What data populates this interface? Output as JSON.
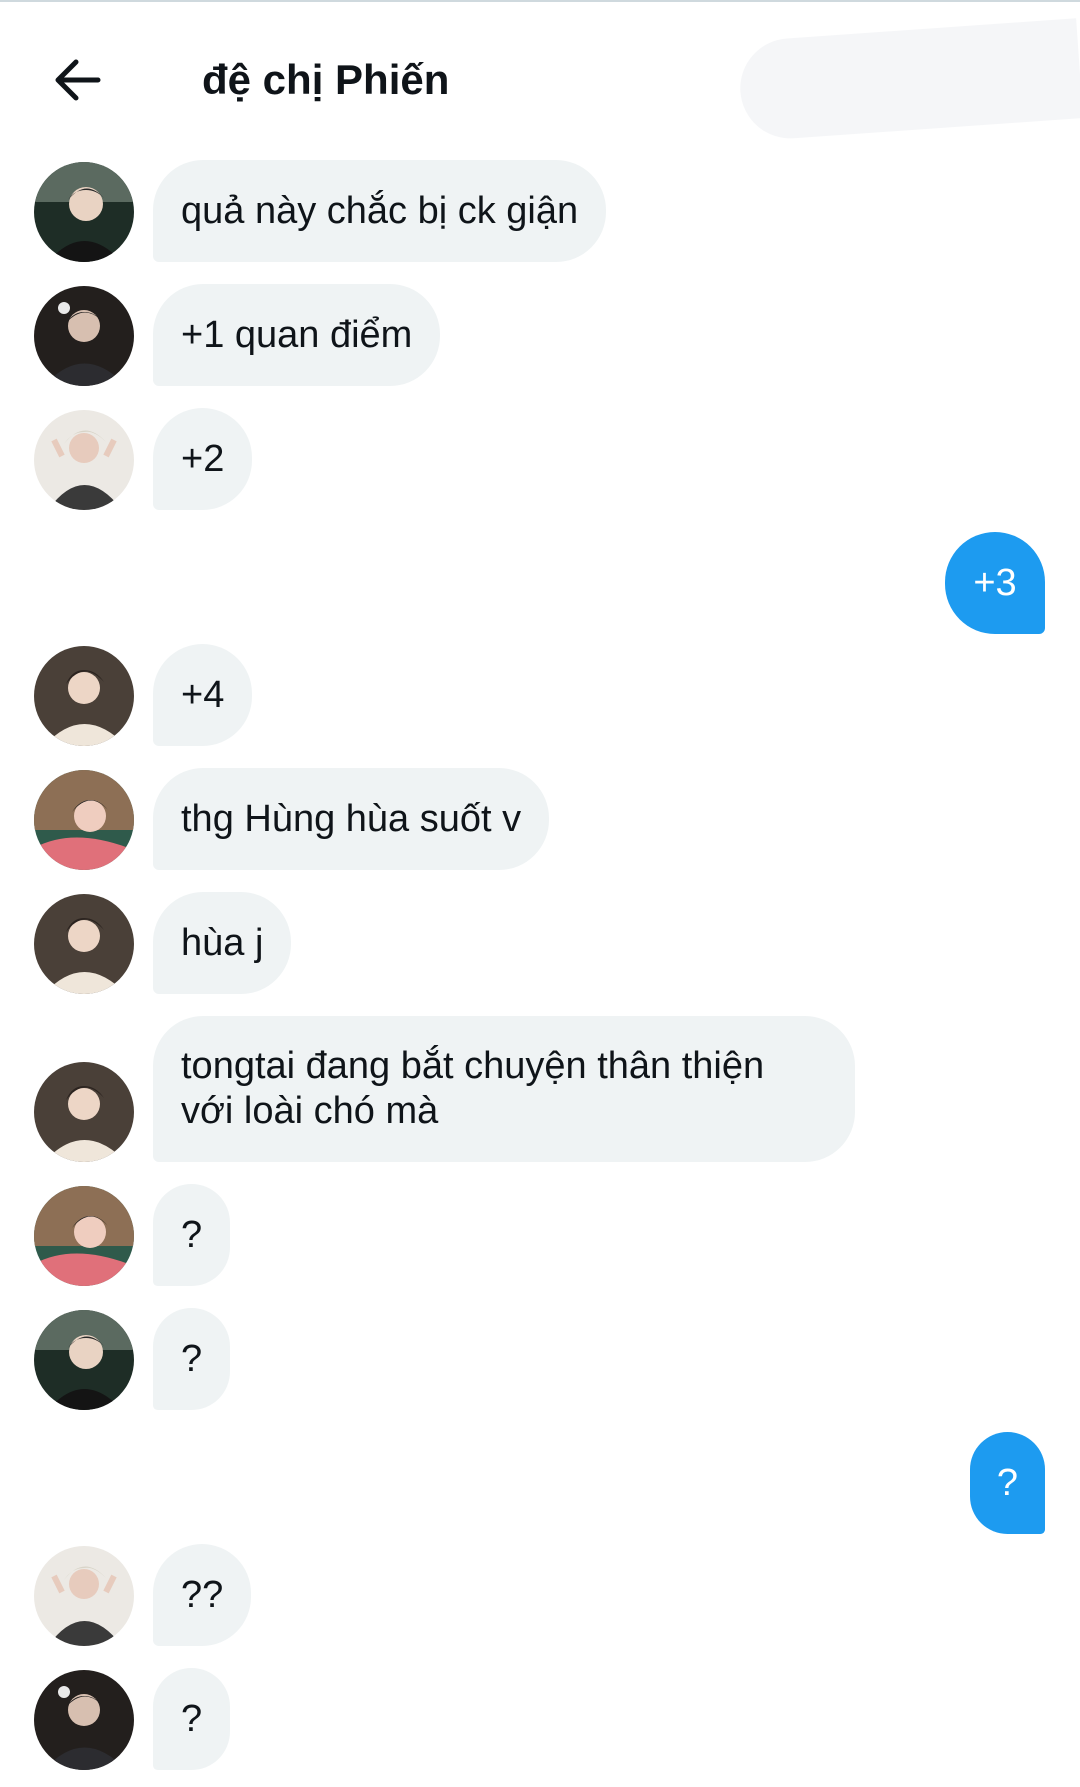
{
  "header": {
    "title": "đệ chị Phiến",
    "back_icon": "arrow-left-icon"
  },
  "colors": {
    "incoming_bubble": "#eff3f4",
    "outgoing_bubble": "#1d9bf0",
    "text": "#0f1419"
  },
  "messages": [
    {
      "sender": "other",
      "avatar": "avatar-a",
      "text": "quả này chắc bị ck giận"
    },
    {
      "sender": "other",
      "avatar": "avatar-b",
      "text": "+1 quan điểm"
    },
    {
      "sender": "other",
      "avatar": "avatar-c",
      "text": "+2"
    },
    {
      "sender": "me",
      "text": "+3"
    },
    {
      "sender": "other",
      "avatar": "avatar-d",
      "text": "+4"
    },
    {
      "sender": "other",
      "avatar": "avatar-e",
      "text": "thg Hùng hùa suốt v"
    },
    {
      "sender": "other",
      "avatar": "avatar-d",
      "text": "hùa j"
    },
    {
      "sender": "other",
      "avatar": "avatar-d",
      "text": "tongtai đang bắt chuyện thân thiện với loài chó mà"
    },
    {
      "sender": "other",
      "avatar": "avatar-e",
      "text": "?"
    },
    {
      "sender": "other",
      "avatar": "avatar-a",
      "text": "?"
    },
    {
      "sender": "me",
      "text": "?"
    },
    {
      "sender": "other",
      "avatar": "avatar-c",
      "text": "??"
    },
    {
      "sender": "other",
      "avatar": "avatar-b",
      "text": "?"
    }
  ]
}
